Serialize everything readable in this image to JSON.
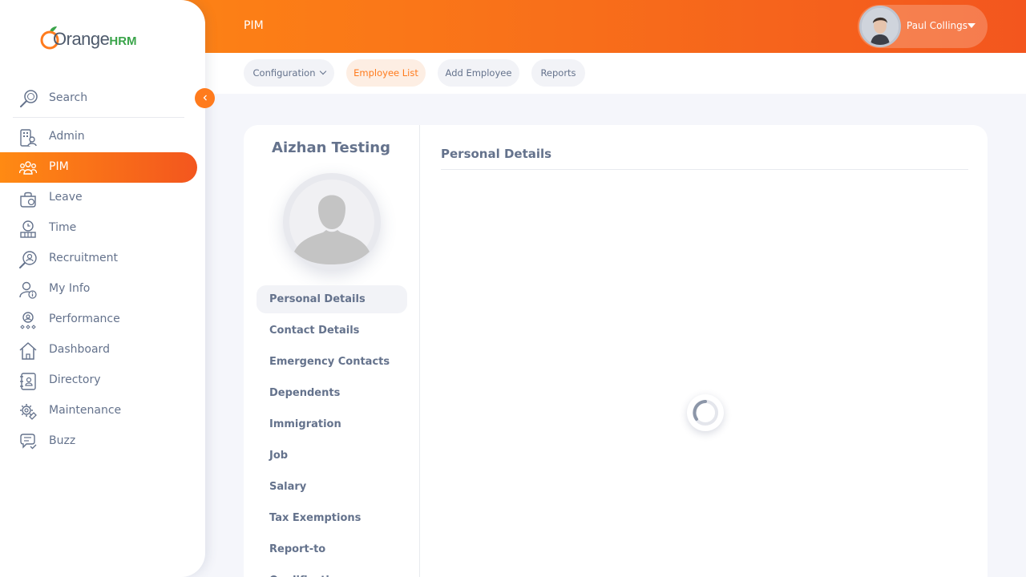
{
  "header": {
    "module_title": "PIM",
    "user_name": "Paul Collings"
  },
  "subnav": {
    "tabs": [
      {
        "label": "Configuration",
        "active": false,
        "has_dropdown": true
      },
      {
        "label": "Employee List",
        "active": true
      },
      {
        "label": "Add Employee",
        "active": false
      },
      {
        "label": "Reports",
        "active": false
      }
    ]
  },
  "brand": {
    "logo_main": "Orange",
    "logo_suffix": "HRM",
    "accent_color": "#ff7b1d"
  },
  "sidebar": {
    "search_label": "Search",
    "collapse_icon": "chevron-left-icon",
    "items": [
      {
        "label": "Admin",
        "icon": "admin-icon",
        "active": false
      },
      {
        "label": "PIM",
        "icon": "pim-icon",
        "active": true
      },
      {
        "label": "Leave",
        "icon": "leave-icon",
        "active": false
      },
      {
        "label": "Time",
        "icon": "time-icon",
        "active": false
      },
      {
        "label": "Recruitment",
        "icon": "recruitment-icon",
        "active": false
      },
      {
        "label": "My Info",
        "icon": "my-info-icon",
        "active": false
      },
      {
        "label": "Performance",
        "icon": "performance-icon",
        "active": false
      },
      {
        "label": "Dashboard",
        "icon": "dashboard-icon",
        "active": false
      },
      {
        "label": "Directory",
        "icon": "directory-icon",
        "active": false
      },
      {
        "label": "Maintenance",
        "icon": "maintenance-icon",
        "active": false
      },
      {
        "label": "Buzz",
        "icon": "buzz-icon",
        "active": false
      }
    ]
  },
  "employee": {
    "name": "Aizhan Testing",
    "tabs": [
      {
        "label": "Personal Details",
        "active": true
      },
      {
        "label": "Contact Details"
      },
      {
        "label": "Emergency Contacts"
      },
      {
        "label": "Dependents"
      },
      {
        "label": "Immigration"
      },
      {
        "label": "Job"
      },
      {
        "label": "Salary"
      },
      {
        "label": "Tax Exemptions"
      },
      {
        "label": "Report-to"
      },
      {
        "label": "Qualifications"
      }
    ]
  },
  "details": {
    "section_title": "Personal Details",
    "loading": true
  }
}
